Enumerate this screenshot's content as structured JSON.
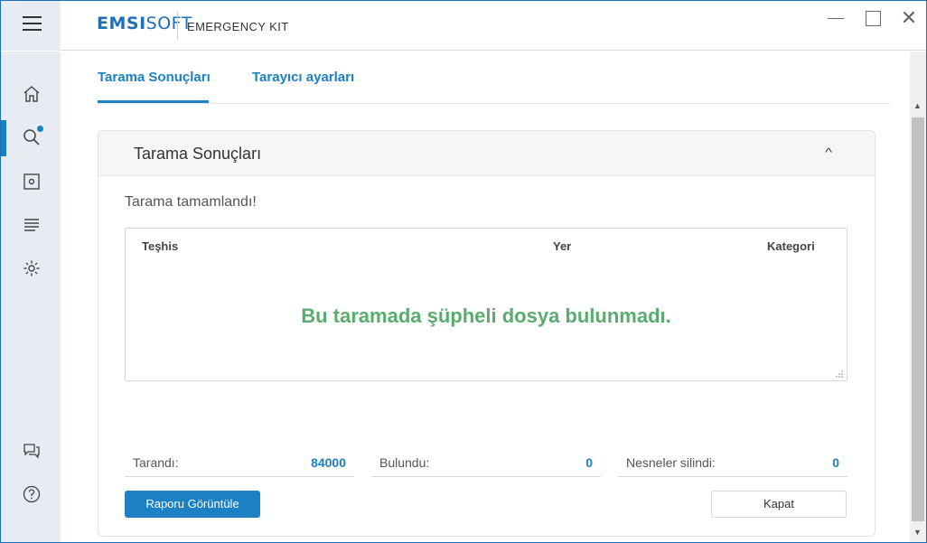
{
  "app": {
    "brand_bold": "EMSI",
    "brand_rest": "SOFT",
    "product": "EMERGENCY KIT",
    "close_glyph": "✕"
  },
  "tabs": [
    {
      "label": "Tarama Sonuçları",
      "active": true
    },
    {
      "label": "Tarayıcı ayarları",
      "active": false
    }
  ],
  "sidebar": {
    "items": [
      {
        "icon": "home-icon"
      },
      {
        "icon": "search-icon",
        "active": true,
        "notification_dot": true
      },
      {
        "icon": "quarantine-icon"
      },
      {
        "icon": "logs-icon"
      },
      {
        "icon": "settings-icon"
      },
      {
        "icon": "feedback-icon"
      },
      {
        "icon": "help-icon"
      }
    ]
  },
  "card": {
    "title": "Tarama Sonuçları",
    "collapse_glyph": "^",
    "status": "Tarama tamamlandı!",
    "table": {
      "columns": [
        "Teşhis",
        "Yer",
        "Kategori"
      ],
      "empty_message": "Bu taramada şüpheli dosya bulunmadı."
    },
    "stats": [
      {
        "label": "Tarandı:",
        "value": "84000"
      },
      {
        "label": "Bulundu:",
        "value": "0"
      },
      {
        "label": "Nesneler silindi:",
        "value": "0"
      }
    ],
    "buttons": {
      "report": "Raporu Görüntüle",
      "close": "Kapat"
    }
  },
  "colors": {
    "accent": "#1c80c4",
    "success": "#5aac6e",
    "sidebar_bg": "#e6ecf2"
  }
}
